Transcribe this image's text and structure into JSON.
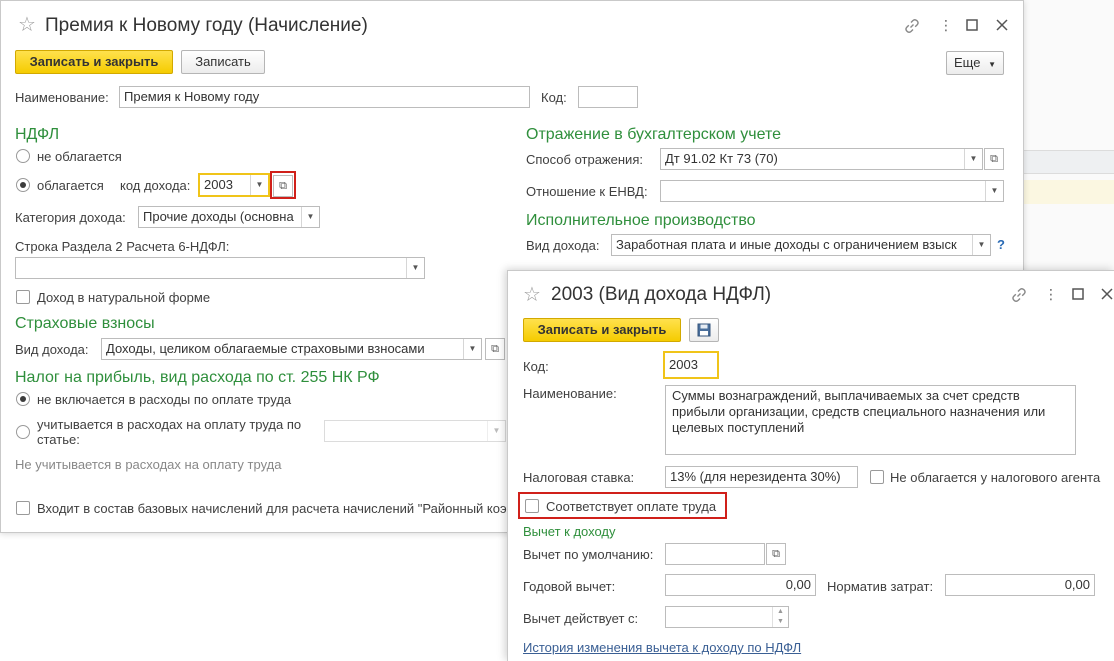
{
  "accrual_window": {
    "title": "Премия к Новому году (Начисление)",
    "toolbar": {
      "save_close": "Записать и закрыть",
      "save": "Записать",
      "more": "Еще"
    },
    "name_label": "Наименование:",
    "name_value": "Премия к Новому году",
    "code_label": "Код:",
    "code_value": "",
    "ndfl": {
      "header": "НДФЛ",
      "not_taxed": "не облагается",
      "taxed": "облагается",
      "income_code_label": "код дохода:",
      "income_code_value": "2003",
      "category_label": "Категория дохода:",
      "category_value": "Прочие доходы (основна",
      "line_6ndfl_label": "Строка Раздела 2 Расчета 6-НДФЛ:",
      "line_6ndfl_value": "",
      "natural_form": "Доход в натуральной форме"
    },
    "insurance": {
      "header": "Страховые взносы",
      "income_type_label": "Вид дохода:",
      "income_type_value": "Доходы, целиком облагаемые страховыми взносами"
    },
    "profit_tax": {
      "header": "Налог на прибыль, вид расхода по ст. 255 НК РФ",
      "not_included": "не включается в расходы по оплате труда",
      "included_line1": "учитывается в расходах на оплату труда по",
      "included_line2": "статье:",
      "article_value": "",
      "note": "Не учитывается в расходах на оплату труда"
    },
    "district_coef": "Входит в состав базовых начислений для расчета начислений \"Районный коэ",
    "accounting": {
      "header": "Отражение в бухгалтерском учете",
      "method_label": "Способ отражения:",
      "method_value": "Дт 91.02 Кт 73 (70)",
      "envd_label": "Отношение к ЕНВД:",
      "envd_value": ""
    },
    "enforcement": {
      "header": "Исполнительное производство",
      "income_type_label": "Вид дохода:",
      "income_type_value": "Заработная плата и иные доходы с ограничением взыск",
      "help": "?"
    }
  },
  "income_type_window": {
    "title": "2003 (Вид дохода НДФЛ)",
    "toolbar": {
      "save_close": "Записать и закрыть"
    },
    "code_label": "Код:",
    "code_value": "2003",
    "name_label": "Наименование:",
    "name_value": "Суммы вознаграждений, выплачиваемых за счет средств прибыли организации, средств специального назначения или целевых поступлений",
    "tax_rate_label": "Налоговая ставка:",
    "tax_rate_value": "13% (для нерезидента 30%)",
    "not_taxed_agent": "Не облагается у налогового агента",
    "labor_payment": "Соответствует оплате труда",
    "deduction_header": "Вычет к доходу",
    "default_deduction_label": "Вычет по умолчанию:",
    "default_deduction_value": "",
    "annual_deduction_label": "Годовой вычет:",
    "annual_deduction_value": "0,00",
    "cost_norm_label": "Норматив затрат:",
    "cost_norm_value": "0,00",
    "valid_from_label": "Вычет действует с:",
    "valid_from_value": "",
    "history_link": "История изменения вычета к доходу по НДФЛ"
  },
  "colors": {
    "accent_yellow": "#f5cc00",
    "section_green": "#2f8f3c",
    "highlight_red": "#d0201a",
    "link_blue": "#3a5f94"
  }
}
